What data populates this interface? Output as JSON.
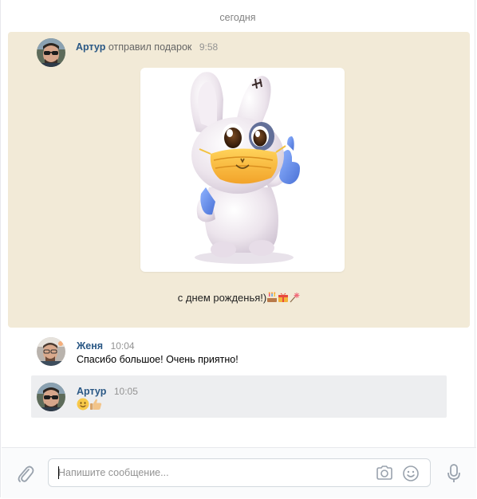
{
  "conversation": {
    "date_divider": "сегодня"
  },
  "gift_message": {
    "author": "Артур",
    "action": "отправил подарок",
    "time": "9:58",
    "caption": "с днем рожденья!)",
    "caption_emojis": [
      "birthday-cake",
      "wrapped-gift",
      "sparkler"
    ],
    "gift_image": "bunny-in-face-mask-thumbs-up",
    "background_color": "#f2ead7"
  },
  "messages": [
    {
      "author": "Женя",
      "time": "10:04",
      "text": "Спасибо большое! Очень приятно!"
    },
    {
      "author": "Артур",
      "time": "10:05",
      "emojis": [
        "smiling-face",
        "thumbs-up"
      ],
      "selected": true
    }
  ],
  "composer": {
    "placeholder": "Напишите сообщение...",
    "value": ""
  },
  "colors": {
    "author_link": "#2a5885",
    "selected_row": "#edeef0",
    "icon": "#99a2ad"
  }
}
